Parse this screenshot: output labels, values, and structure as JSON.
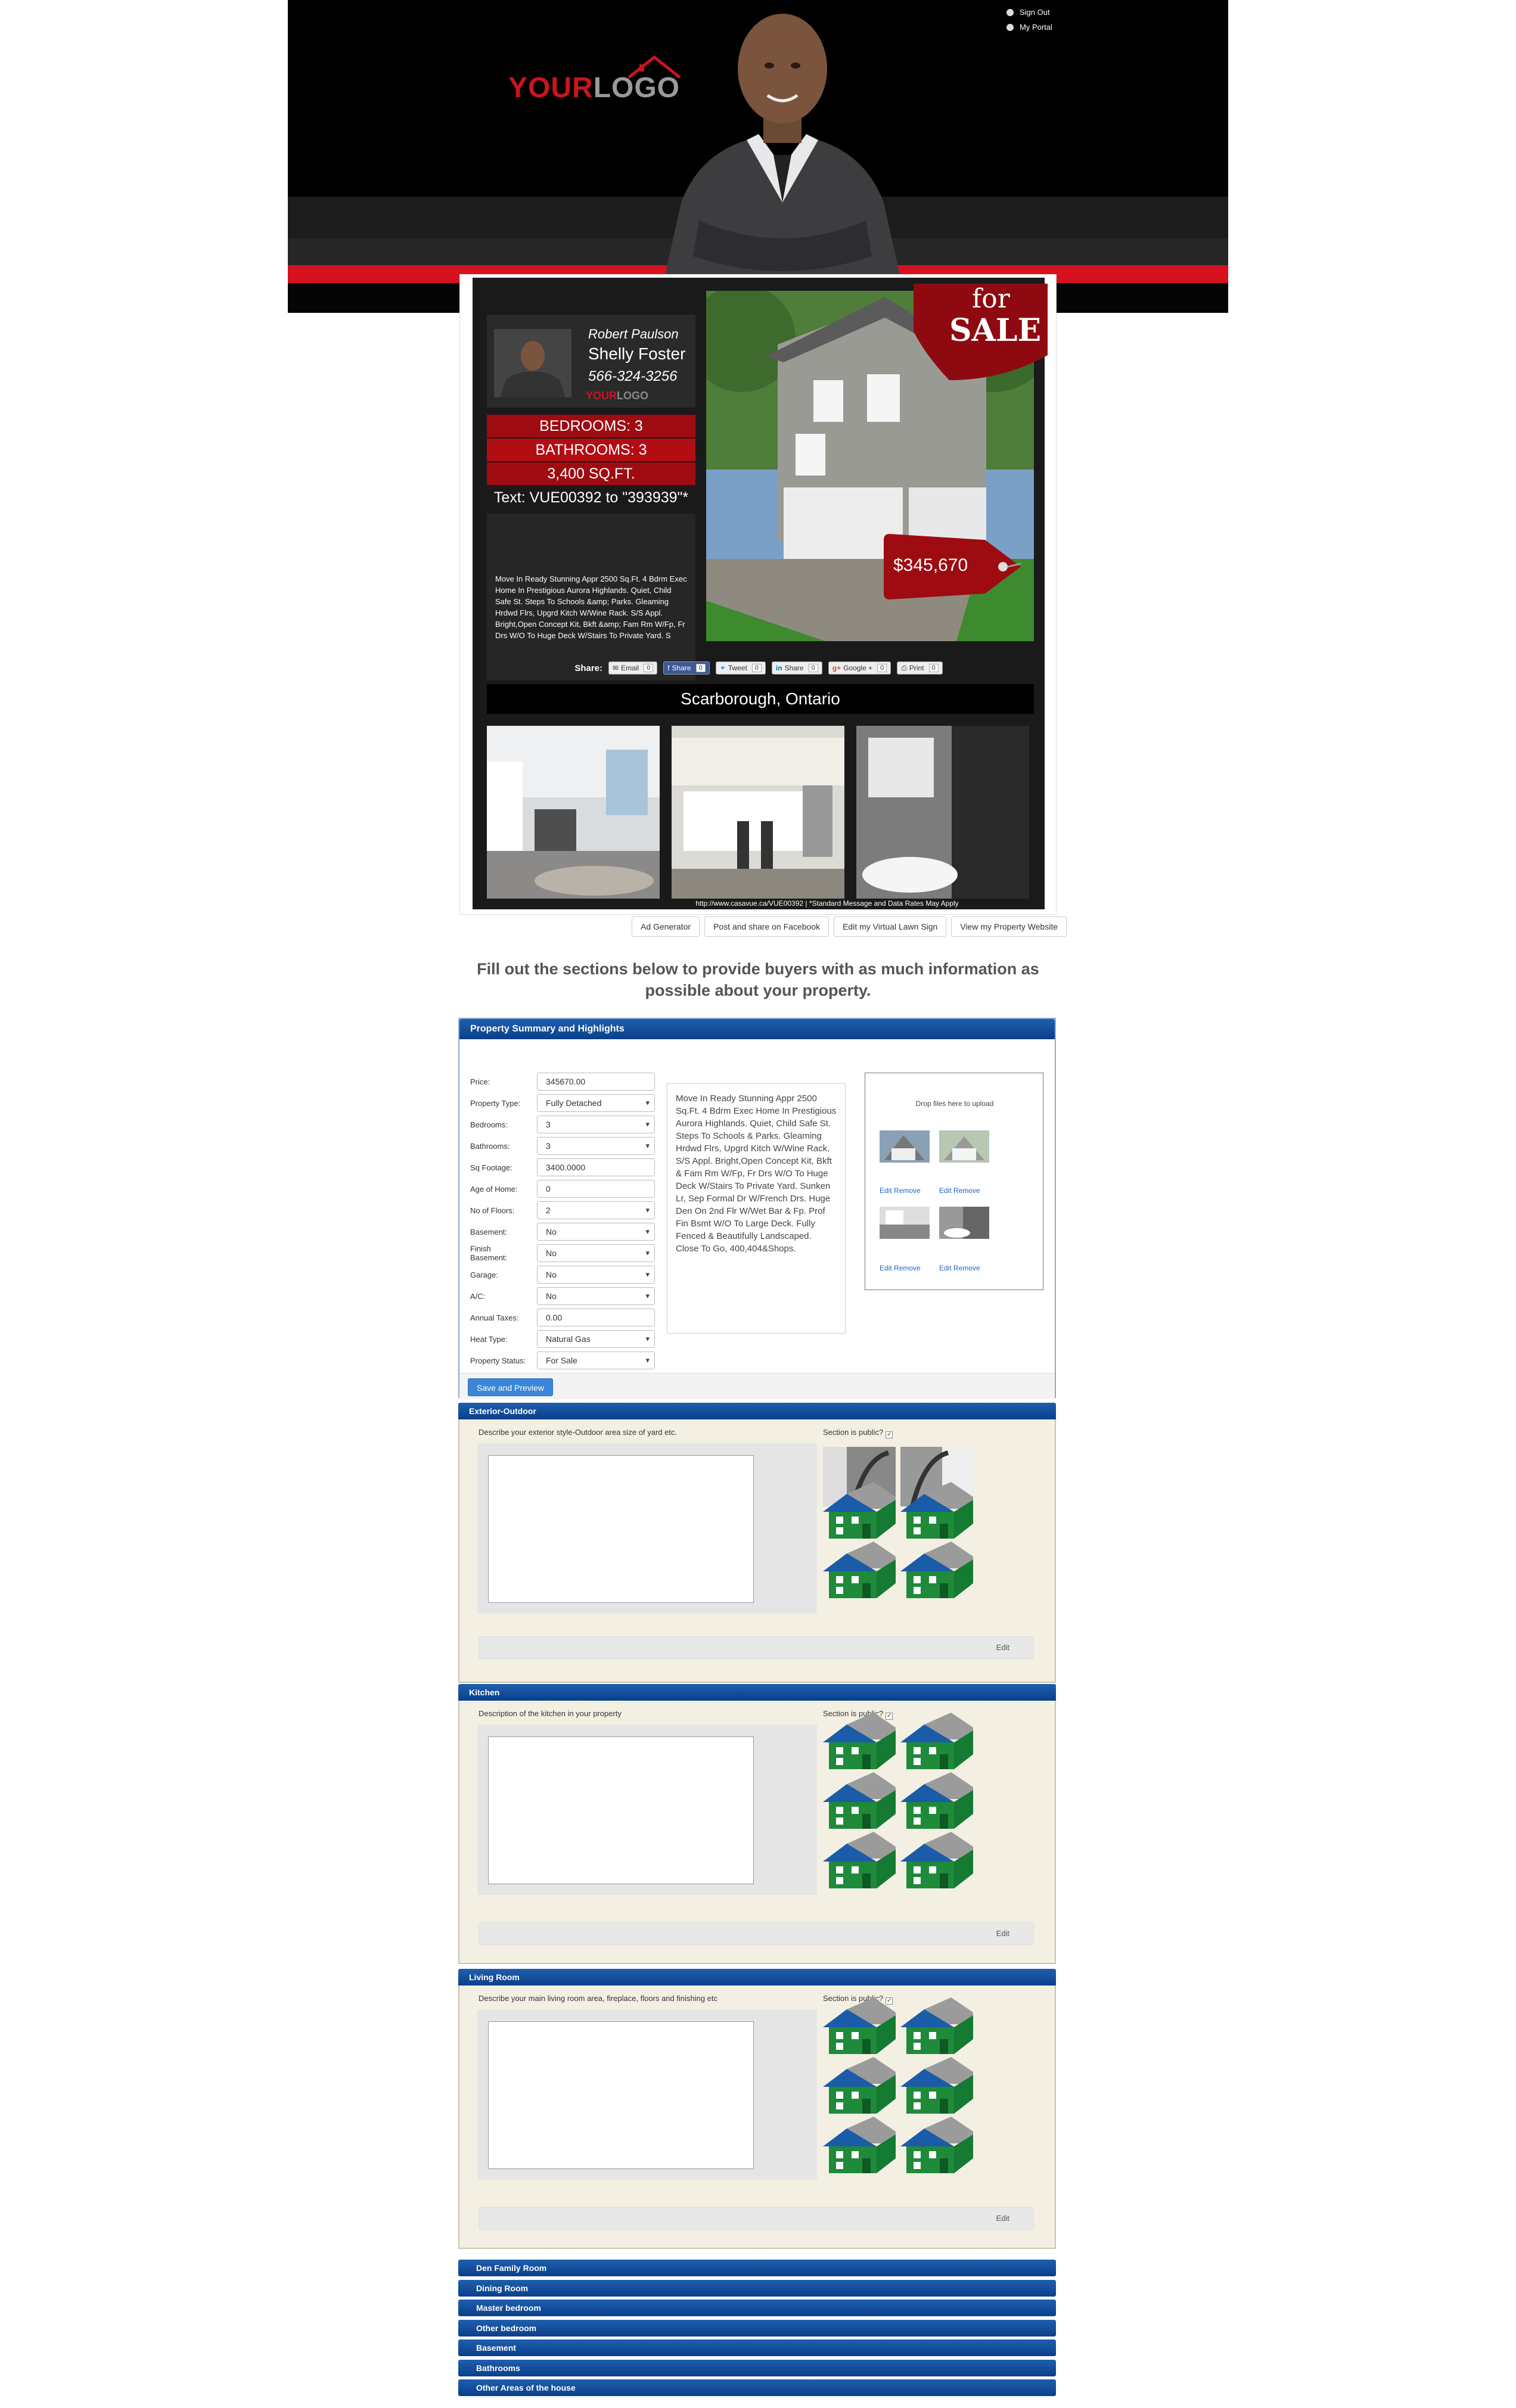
{
  "header": {
    "logo_part1": "YOUR",
    "logo_part2": "LOGO",
    "links": [
      {
        "label": "Sign Out",
        "icon": "sign-out-icon"
      },
      {
        "label": "My Portal",
        "icon": "portal-icon"
      }
    ]
  },
  "flyer": {
    "agent_line1": "Robert Paulson",
    "agent_name": "Shelly Foster",
    "agent_phone": "566-324-3256",
    "card_logo_part1": "YOUR",
    "card_logo_part2": "LOGO",
    "bedrooms": "BEDROOMS: 3",
    "bathrooms": "BATHROOMS: 3",
    "sqft": "3,400 SQ.FT.",
    "text_line": "Text: VUE00392 to \"393939\"*",
    "description": "Move In Ready Stunning Appr 2500 Sq.Ft. 4 Bdrm Exec Home In Prestigious Aurora Highlands. Quiet, Child Safe St. Steps To Schools &amp; Parks. Gleaming Hrdwd Flrs, Upgrd Kitch W/Wine Rack. S/S Appl. Bright,Open Concept Kit, Bkft &amp; Fam Rm W/Fp, Fr Drs W/O To Huge Deck W/Stairs To Private Yard. S",
    "for_label": "for",
    "sale_label": "SALE",
    "price": "$345,670",
    "share_label": "Share:",
    "share_buttons": [
      {
        "label": "Email",
        "count": "0"
      },
      {
        "label": "Share",
        "count": "0"
      },
      {
        "label": "Tweet",
        "count": "0"
      },
      {
        "label": "Share",
        "count": "0"
      },
      {
        "label": "Google +",
        "count": "0"
      },
      {
        "label": "Print",
        "count": "0"
      }
    ],
    "location": "Scarborough, Ontario",
    "footer": "http://www.casavue.ca/VUE00392  |  *Standard Message and Data Rates May Apply"
  },
  "actions": [
    "Ad Generator",
    "Post and share on Facebook",
    "Edit my Virtual Lawn Sign",
    "View my Property Website"
  ],
  "instructions": "Fill out the sections below to provide buyers with as much information as possible about your property.",
  "summary": {
    "title": "Property Summary and Highlights",
    "fields": [
      {
        "label": "Price:",
        "value": "345670.00",
        "type": "text"
      },
      {
        "label": "Property Type:",
        "value": "Fully Detached",
        "type": "select"
      },
      {
        "label": "Bedrooms:",
        "value": "3",
        "type": "select"
      },
      {
        "label": "Bathrooms:",
        "value": "3",
        "type": "select"
      },
      {
        "label": "Sq Footage:",
        "value": "3400.0000",
        "type": "text"
      },
      {
        "label": "Age of Home:",
        "value": "0",
        "type": "text"
      },
      {
        "label": "No of Floors:",
        "value": "2",
        "type": "select"
      },
      {
        "label": "Basement:",
        "value": "No",
        "type": "select"
      },
      {
        "label": "Finish Basement:",
        "value": "No",
        "type": "select"
      },
      {
        "label": "Garage:",
        "value": "No",
        "type": "select"
      },
      {
        "label": "A/C:",
        "value": "No",
        "type": "select"
      },
      {
        "label": "Annual Taxes:",
        "value": "0.00",
        "type": "text"
      },
      {
        "label": "Heat Type:",
        "value": "Natural Gas",
        "type": "select"
      },
      {
        "label": "Property Status:",
        "value": "For Sale",
        "type": "select"
      }
    ],
    "description": "Move In Ready Stunning Appr 2500 Sq.Ft. 4 Bdrm Exec Home In Prestigious Aurora Highlands. Quiet, Child Safe St. Steps To Schools & Parks. Gleaming Hrdwd Flrs, Upgrd Kitch W/Wine Rack. S/S Appl. Bright,Open Concept Kit, Bkft & Fam Rm W/Fp, Fr Drs W/O To Huge Deck W/Stairs To Private Yard. Sunken Lr, Sep Formal Dr W/French Drs. Huge Den On 2nd Flr W/Wet Bar & Fp. Prof Fin Bsmt W/O To Large Deck. Fully Fenced & Beautifully Landscaped. Close To Go, 400,404&Shops.",
    "drop_text": "Drop files here to upload",
    "edit_label": "Edit",
    "remove_label": "Remove",
    "save_label": "Save and Preview"
  },
  "sections": [
    {
      "title": "Exterior-Outdoor",
      "prompt": "Describe your exterior style-Outdoor area size of yard etc.",
      "public_label": "Section is public?",
      "edit_label": "Edit"
    },
    {
      "title": "Kitchen",
      "prompt": "Description of the kitchen in your property",
      "public_label": "Section is public?",
      "edit_label": "Edit"
    },
    {
      "title": "Living Room",
      "prompt": "Describe your main living room area, fireplace, floors and finishing etc",
      "public_label": "Section is public?",
      "edit_label": "Edit"
    }
  ],
  "collapsed_sections": [
    "Den Family Room",
    "Dining Room",
    "Master bedroom",
    "Other bedroom",
    "Basement",
    "Bathrooms",
    "Other Areas of the house"
  ],
  "colors": {
    "brand_red": "#d8111f",
    "panel_blue": "#0b3f8a",
    "house_green": "#1e8a3a"
  }
}
